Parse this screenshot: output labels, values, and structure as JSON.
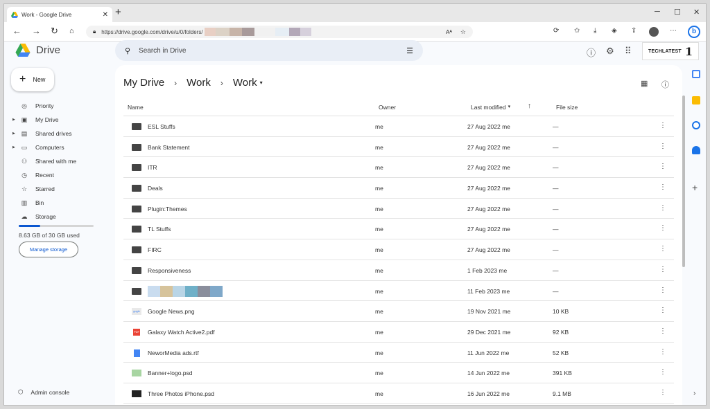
{
  "browser": {
    "tab_title": "Work - Google Drive",
    "url_text": "https://drive.google.com/drive/u/0/folders/"
  },
  "app": {
    "logo_text": "Drive",
    "search_placeholder": "Search in Drive",
    "brand_text": "TECHLATEST",
    "brand_mark": "1"
  },
  "sidebar": {
    "new_label": "New",
    "items": [
      {
        "label": "Priority",
        "icon": "circle-check-icon",
        "glyph": "◎",
        "caret": false
      },
      {
        "label": "My Drive",
        "icon": "my-drive-icon",
        "glyph": "▣",
        "caret": true
      },
      {
        "label": "Shared drives",
        "icon": "shared-drives-icon",
        "glyph": "▤",
        "caret": true
      },
      {
        "label": "Computers",
        "icon": "computer-icon",
        "glyph": "▭",
        "caret": true
      },
      {
        "label": "Shared with me",
        "icon": "people-icon",
        "glyph": "⚇",
        "caret": false
      },
      {
        "label": "Recent",
        "icon": "clock-icon",
        "glyph": "◷",
        "caret": false
      },
      {
        "label": "Starred",
        "icon": "star-icon",
        "glyph": "☆",
        "caret": false
      },
      {
        "label": "Bin",
        "icon": "trash-icon",
        "glyph": "▥",
        "caret": false
      },
      {
        "label": "Storage",
        "icon": "cloud-icon",
        "glyph": "☁",
        "caret": false
      }
    ],
    "storage_used": "8.63 GB of 30 GB used",
    "storage_fraction": 0.29,
    "manage_storage": "Manage storage",
    "admin_console": "Admin console"
  },
  "main": {
    "breadcrumb": [
      "My Drive",
      "Work",
      "Work"
    ],
    "columns": {
      "name": "Name",
      "owner": "Owner",
      "modified": "Last modified",
      "size": "File size"
    },
    "files": [
      {
        "name": "ESL Stuffs",
        "type": "folder",
        "owner": "me",
        "modified": "27 Aug 2022 me",
        "size": "—"
      },
      {
        "name": "Bank Statement",
        "type": "folder",
        "owner": "me",
        "modified": "27 Aug 2022 me",
        "size": "—"
      },
      {
        "name": "ITR",
        "type": "folder",
        "owner": "me",
        "modified": "27 Aug 2022 me",
        "size": "—"
      },
      {
        "name": "Deals",
        "type": "folder",
        "owner": "me",
        "modified": "27 Aug 2022 me",
        "size": "—"
      },
      {
        "name": "Plugin:Themes",
        "type": "folder",
        "owner": "me",
        "modified": "27 Aug 2022 me",
        "size": "—"
      },
      {
        "name": "TL Stuffs",
        "type": "folder",
        "owner": "me",
        "modified": "27 Aug 2022 me",
        "size": "—"
      },
      {
        "name": "FIRC",
        "type": "folder",
        "owner": "me",
        "modified": "27 Aug 2022 me",
        "size": "—"
      },
      {
        "name": "Responsiveness",
        "type": "shared-folder",
        "owner": "me",
        "modified": "1 Feb 2023 me",
        "size": "—"
      },
      {
        "name": "",
        "type": "shared-folder",
        "owner": "me",
        "modified": "11 Feb 2023 me",
        "size": "—"
      },
      {
        "name": "Google News.png",
        "type": "png",
        "owner": "me",
        "modified": "19 Nov 2021 me",
        "size": "10 KB"
      },
      {
        "name": "Galaxy Watch Active2.pdf",
        "type": "pdf",
        "owner": "me",
        "modified": "29 Dec 2021 me",
        "size": "92 KB"
      },
      {
        "name": "NeworMedia ads.rtf",
        "type": "doc",
        "owner": "me",
        "modified": "11 Jun 2022 me",
        "size": "52 KB"
      },
      {
        "name": "Banner+logo.psd",
        "type": "psd1",
        "owner": "me",
        "modified": "14 Jun 2022 me",
        "size": "391 KB"
      },
      {
        "name": "Three Photos iPhone.psd",
        "type": "psd2",
        "owner": "me",
        "modified": "16 Jun 2022 me",
        "size": "9.1 MB"
      }
    ]
  },
  "colors": {
    "accent": "#0b57d0",
    "search_bg": "#e9eef6",
    "page_bg": "#f8fafd"
  }
}
